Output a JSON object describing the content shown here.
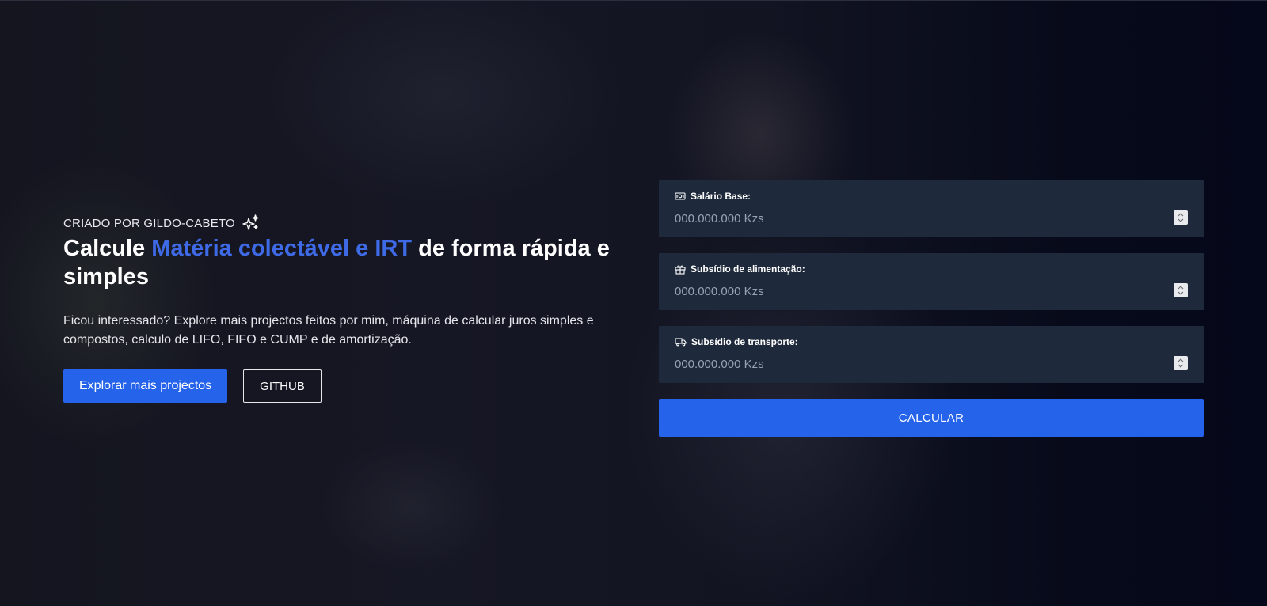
{
  "hero": {
    "eyebrow": "CRIADO POR GILDO-CABETO",
    "eyebrow_icon": "sparkles-icon",
    "headline_prefix": "Calcule ",
    "headline_accent": "Matéria colectável e IRT",
    "headline_suffix": " de forma rápida e simples",
    "description": "Ficou interessado? Explore mais projectos feitos por mim, máquina de calcular juros simples e compostos, calculo de LIFO, FIFO e CUMP e de amortização.",
    "primary_button": "Explorar mais projectos",
    "secondary_button": "GITHUB"
  },
  "form": {
    "fields": [
      {
        "label": "Salário Base:",
        "icon": "money-icon",
        "placeholder": "000.000.000 Kzs",
        "value": ""
      },
      {
        "label": "Subsídio de alimentação:",
        "icon": "gift-icon",
        "placeholder": "000.000.000 Kzs",
        "value": ""
      },
      {
        "label": "Subsídio de transporte:",
        "icon": "truck-icon",
        "placeholder": "000.000.000 Kzs",
        "value": ""
      }
    ],
    "submit_label": "CALCULAR"
  },
  "colors": {
    "accent": "#2563eb",
    "accent_text": "#3e6ae6",
    "field_bg": "#1e293b"
  }
}
